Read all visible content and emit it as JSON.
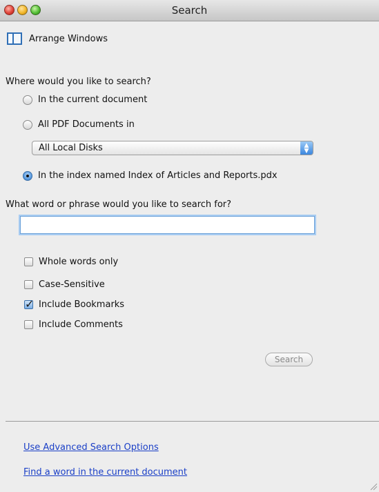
{
  "window": {
    "title": "Search"
  },
  "toolbar": {
    "arrange_label": "Arrange Windows",
    "arrange_icon": "arrange-windows-icon"
  },
  "where": {
    "question": "Where would you like to search?",
    "options": [
      {
        "label": "In the current document",
        "checked": false
      },
      {
        "label": "All PDF Documents in",
        "checked": false
      },
      {
        "label": "In the index named Index of Articles and Reports.pdx",
        "checked": true
      }
    ],
    "location_select": {
      "selected": "All Local Disks"
    }
  },
  "what": {
    "question": "What word or phrase would you like to search for?",
    "input_value": "",
    "input_placeholder": ""
  },
  "options": [
    {
      "label": "Whole words only",
      "checked": false
    },
    {
      "label": "Case-Sensitive",
      "checked": false
    },
    {
      "label": "Include Bookmarks",
      "checked": true
    },
    {
      "label": "Include Comments",
      "checked": false
    }
  ],
  "actions": {
    "search_label": "Search"
  },
  "links": {
    "advanced": "Use Advanced Search Options",
    "find_word": "Find a word in the current document"
  },
  "colors": {
    "link": "#1a3fc7",
    "accent": "#2f6fb6",
    "window_bg": "#ededed"
  }
}
